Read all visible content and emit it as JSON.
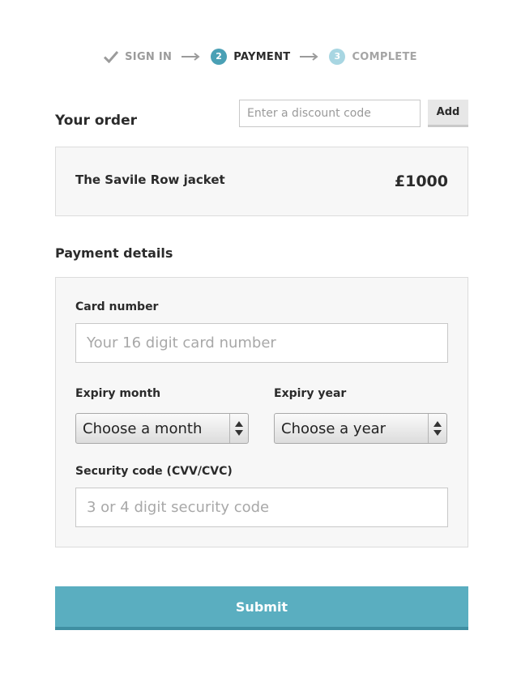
{
  "steps": [
    {
      "label": "SIGN IN",
      "state": "done",
      "icon": "check-icon"
    },
    {
      "label": "PAYMENT",
      "number": "2",
      "state": "active"
    },
    {
      "label": "COMPLETE",
      "number": "3",
      "state": "todo"
    }
  ],
  "order": {
    "title": "Your order",
    "discount_placeholder": "Enter a discount code",
    "add_label": "Add",
    "product_name": "The Savile Row jacket",
    "product_price": "£1000"
  },
  "payment": {
    "title": "Payment details",
    "card_number_label": "Card number",
    "card_number_placeholder": "Your 16 digit card number",
    "expiry_month_label": "Expiry month",
    "expiry_month_value": "Choose a month",
    "expiry_year_label": "Expiry year",
    "expiry_year_value": "Choose a year",
    "security_code_label": "Security code (CVV/CVC)",
    "security_code_placeholder": "3 or 4 digit security code"
  },
  "submit_label": "Submit",
  "colors": {
    "accent": "#5aaec0",
    "step_active": "#4aa0b5",
    "step_todo": "#a8d6e2"
  }
}
